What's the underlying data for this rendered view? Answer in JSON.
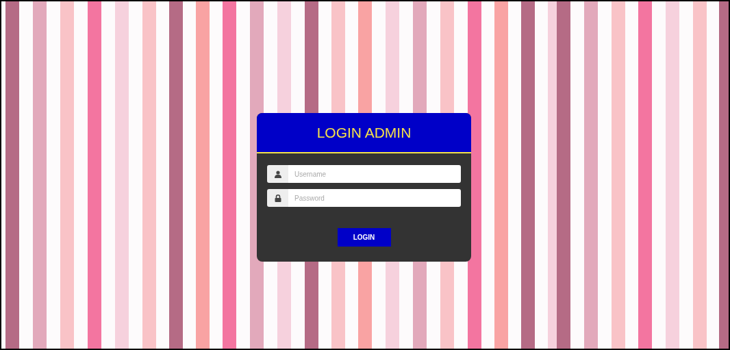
{
  "login_card": {
    "title": "LOGIN ADMIN",
    "fields": [
      {
        "kind": "user",
        "placeholder": "Username"
      },
      {
        "kind": "lock",
        "placeholder": "Password"
      }
    ],
    "button": "LOGIN"
  }
}
